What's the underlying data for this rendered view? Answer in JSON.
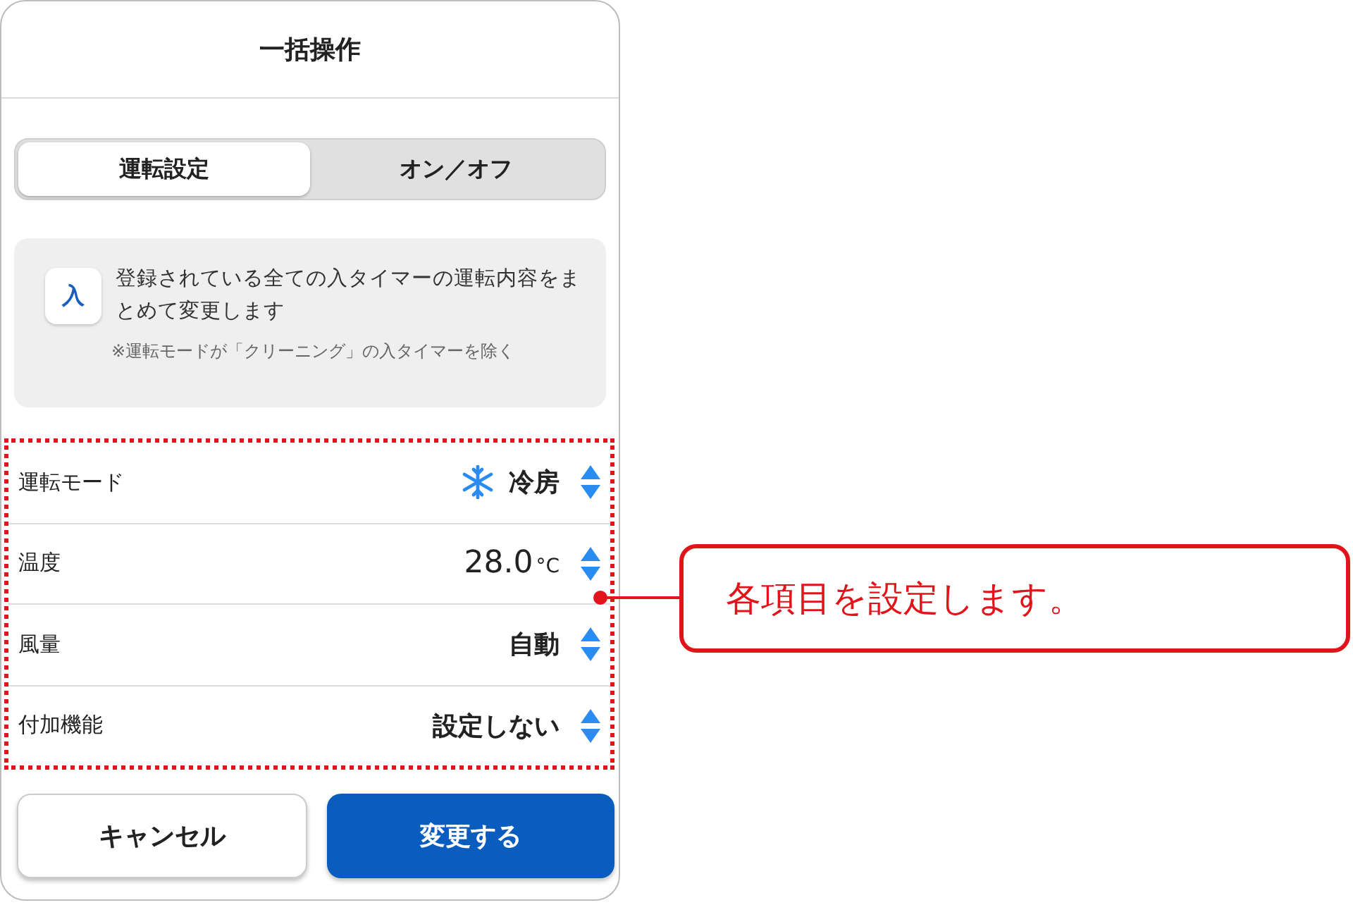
{
  "header": {
    "title": "一括操作"
  },
  "tabs": [
    {
      "label": "運転設定",
      "selected": true
    },
    {
      "label": "オン／オフ",
      "selected": false
    }
  ],
  "info": {
    "badge": "入",
    "text": "登録されている全ての入タイマーの運転内容をまとめて変更します",
    "note": "※運転モードが「クリーニング」の入タイマーを除く"
  },
  "settings": [
    {
      "kind": "mode",
      "label": "運転モード",
      "value": "冷房"
    },
    {
      "kind": "temperature",
      "label": "温度",
      "value": "28.0",
      "unit": "°C"
    },
    {
      "kind": "plain",
      "label": "風量",
      "value": "自動"
    },
    {
      "kind": "plain",
      "label": "付加機能",
      "value": "設定しない"
    }
  ],
  "buttons": [
    {
      "kind": "secondary",
      "label": "キャンセル"
    },
    {
      "kind": "primary",
      "label": "変更する"
    }
  ],
  "callout": {
    "text": "各項目を設定します。"
  }
}
